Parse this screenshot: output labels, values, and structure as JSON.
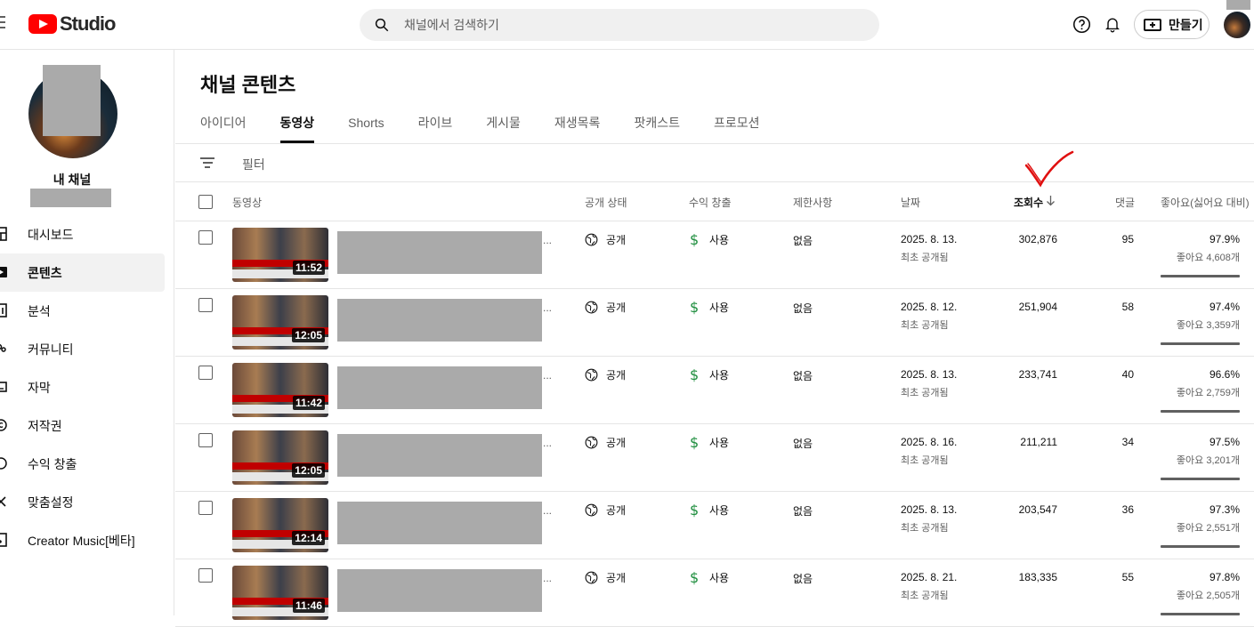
{
  "app": {
    "logo_text": "Studio"
  },
  "search": {
    "placeholder": "채널에서 검색하기"
  },
  "header": {
    "create_label": "만들기"
  },
  "sidebar": {
    "channel_label": "내 채널",
    "items": [
      {
        "label": "대시보드",
        "icon": "dashboard-icon"
      },
      {
        "label": "콘텐츠",
        "icon": "content-icon",
        "active": true
      },
      {
        "label": "분석",
        "icon": "analytics-icon"
      },
      {
        "label": "커뮤니티",
        "icon": "community-icon"
      },
      {
        "label": "자막",
        "icon": "subtitles-icon"
      },
      {
        "label": "저작권",
        "icon": "copyright-icon"
      },
      {
        "label": "수익 창출",
        "icon": "monetization-icon"
      },
      {
        "label": "맞춤설정",
        "icon": "customization-icon"
      },
      {
        "label": "Creator Music[베타]",
        "icon": "music-icon"
      }
    ]
  },
  "main": {
    "title": "채널 콘텐츠",
    "tabs": [
      "아이디어",
      "동영상",
      "Shorts",
      "라이브",
      "게시물",
      "재생목록",
      "팟캐스트",
      "프로모션"
    ],
    "active_tab": "동영상",
    "filter_placeholder": "필터",
    "columns": {
      "video": "동영상",
      "visibility": "공개 상태",
      "monetization": "수익 창출",
      "restrictions": "제한사항",
      "date": "날짜",
      "views": "조회수",
      "comments": "댓글",
      "likes": "좋아요(싫어요 대비)"
    },
    "rows": [
      {
        "duration": "11:52",
        "dots": "...",
        "visibility": "공개",
        "monetization": "사용",
        "restrictions": "없음",
        "date": "2025. 8. 13.",
        "date_sub": "최초 공개됨",
        "views": "302,876",
        "comments": "95",
        "like_pct": "97.9%",
        "like_count": "좋아요 4,608개"
      },
      {
        "duration": "12:05",
        "dots": "...",
        "visibility": "공개",
        "monetization": "사용",
        "restrictions": "없음",
        "date": "2025. 8. 12.",
        "date_sub": "최초 공개됨",
        "views": "251,904",
        "comments": "58",
        "like_pct": "97.4%",
        "like_count": "좋아요 3,359개"
      },
      {
        "duration": "11:42",
        "dots": "...",
        "visibility": "공개",
        "monetization": "사용",
        "restrictions": "없음",
        "date": "2025. 8. 13.",
        "date_sub": "최초 공개됨",
        "views": "233,741",
        "comments": "40",
        "like_pct": "96.6%",
        "like_count": "좋아요 2,759개"
      },
      {
        "duration": "12:05",
        "dots": "...",
        "visibility": "공개",
        "monetization": "사용",
        "restrictions": "없음",
        "date": "2025. 8. 16.",
        "date_sub": "최초 공개됨",
        "views": "211,211",
        "comments": "34",
        "like_pct": "97.5%",
        "like_count": "좋아요 3,201개"
      },
      {
        "duration": "12:14",
        "dots": "...",
        "visibility": "공개",
        "monetization": "사용",
        "restrictions": "없음",
        "date": "2025. 8. 13.",
        "date_sub": "최초 공개됨",
        "views": "203,547",
        "comments": "36",
        "like_pct": "97.3%",
        "like_count": "좋아요 2,551개"
      },
      {
        "duration": "11:46",
        "dots": "...",
        "visibility": "공개",
        "monetization": "사용",
        "restrictions": "없음",
        "date": "2025. 8. 21.",
        "date_sub": "최초 공개됨",
        "views": "183,335",
        "comments": "55",
        "like_pct": "97.8%",
        "like_count": "좋아요 2,505개"
      }
    ]
  },
  "colors": {
    "brand_red": "#ff0000",
    "monetization_green": "#1e8e3e",
    "annotation_red": "#e01010"
  }
}
